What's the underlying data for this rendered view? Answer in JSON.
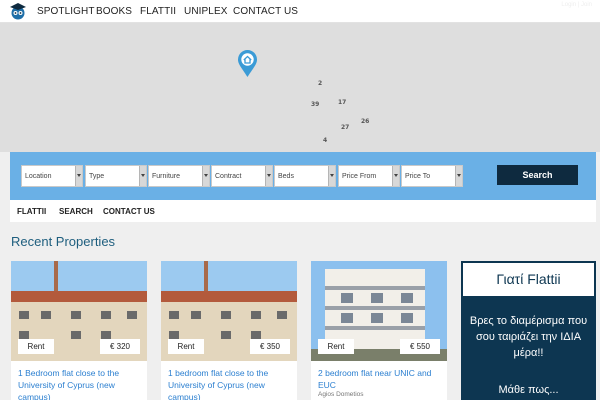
{
  "topnav": {
    "logo_icon": "graduation-owl-icon",
    "items": [
      "SPOTLIGHT",
      "BOOKS",
      "FLATTII",
      "UNIPLEX",
      "CONTACT US"
    ],
    "login": "Login | Join"
  },
  "map": {
    "clusters": [
      "2",
      "39",
      "17",
      "27",
      "26",
      "4"
    ],
    "pin_icon": "home-pin-icon",
    "pin_color": "#3b9bd6"
  },
  "search": {
    "filters": [
      "Location",
      "Type",
      "Furniture",
      "Contract",
      "Beds",
      "Price From",
      "Price To"
    ],
    "button": "Search",
    "bar_color": "#6ab0e6"
  },
  "subnav": {
    "items": [
      "FLATTII",
      "SEARCH",
      "CONTACT US"
    ]
  },
  "section_title": "Recent Properties",
  "properties": [
    {
      "type": "Rent",
      "price": "€ 320",
      "title": "1 Bedroom flat close to the University of Cyprus (new campus)",
      "location": ""
    },
    {
      "type": "Rent",
      "price": "€ 350",
      "title": "1 bedroom flat close to the University of Cyprus (new campus)",
      "location": ""
    },
    {
      "type": "Rent",
      "price": "€ 550",
      "title": "2 bedroom flat near UNIC and EUC",
      "location": "Agios Dometios"
    }
  ],
  "promo": {
    "heading": "Γιατί Flattii",
    "text": "Βρες το διαμέρισμα που σου ταιριάζει την ΙΔΙΑ μέρα!!",
    "more": "Μάθε πως...",
    "bg_color": "#0d3651"
  }
}
